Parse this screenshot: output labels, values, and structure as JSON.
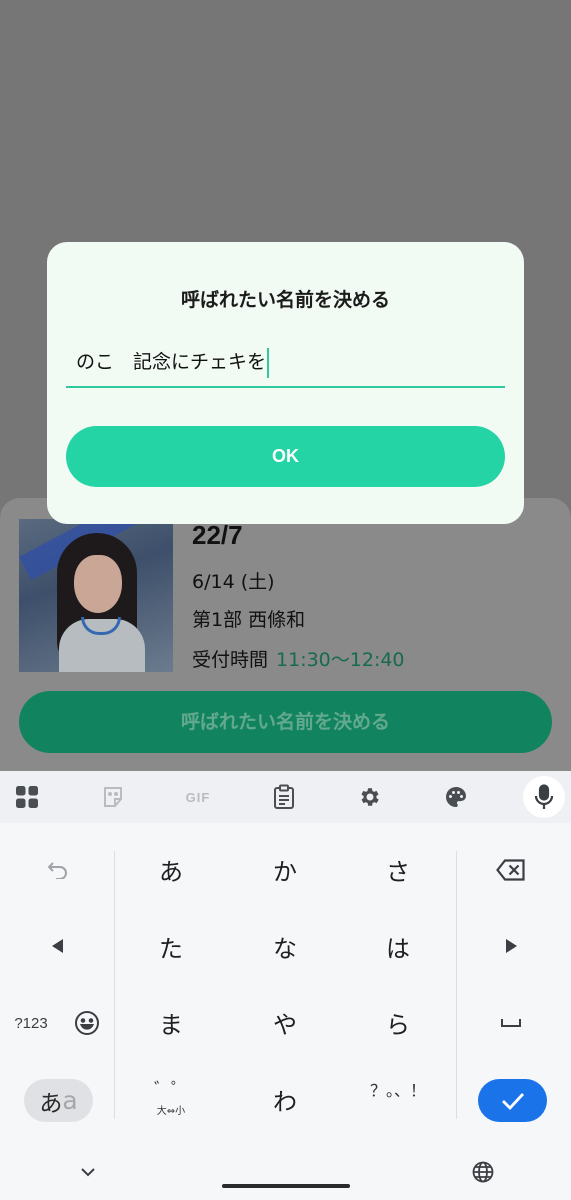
{
  "event_card": {
    "group": "22/7",
    "date": "6/14 (土)",
    "part": "第1部 西條和",
    "reception_label": "受付時間",
    "reception_time": "11:30〜12:40",
    "button_label": "呼ばれたい名前を決める"
  },
  "dialog": {
    "title": "呼ばれたい名前を決める",
    "input_value": "のこ　記念にチェキを",
    "ok_label": "OK"
  },
  "keyboard": {
    "toolbar": [
      "apps-icon",
      "sticker-icon",
      "GIF",
      "clipboard-icon",
      "gear-icon",
      "palette-icon",
      "mic-icon"
    ],
    "gif_label": "GIF",
    "keys": [
      "あ",
      "か",
      "さ",
      "た",
      "な",
      "は",
      "ま",
      "や",
      "ら",
      "わ"
    ],
    "dakuten_label": "゛゜",
    "dakuten_sub": "大⇔小",
    "punct_label": "？。、！",
    "num_mode_label": "?123",
    "kana_mode_label": "あ",
    "kana_mode_alt": "a",
    "accent_color": "#1a73e8"
  },
  "colors": {
    "ok_button": "#25d4a5",
    "input_underline": "#2ec89c",
    "dialog_bg": "#f2faf4"
  }
}
